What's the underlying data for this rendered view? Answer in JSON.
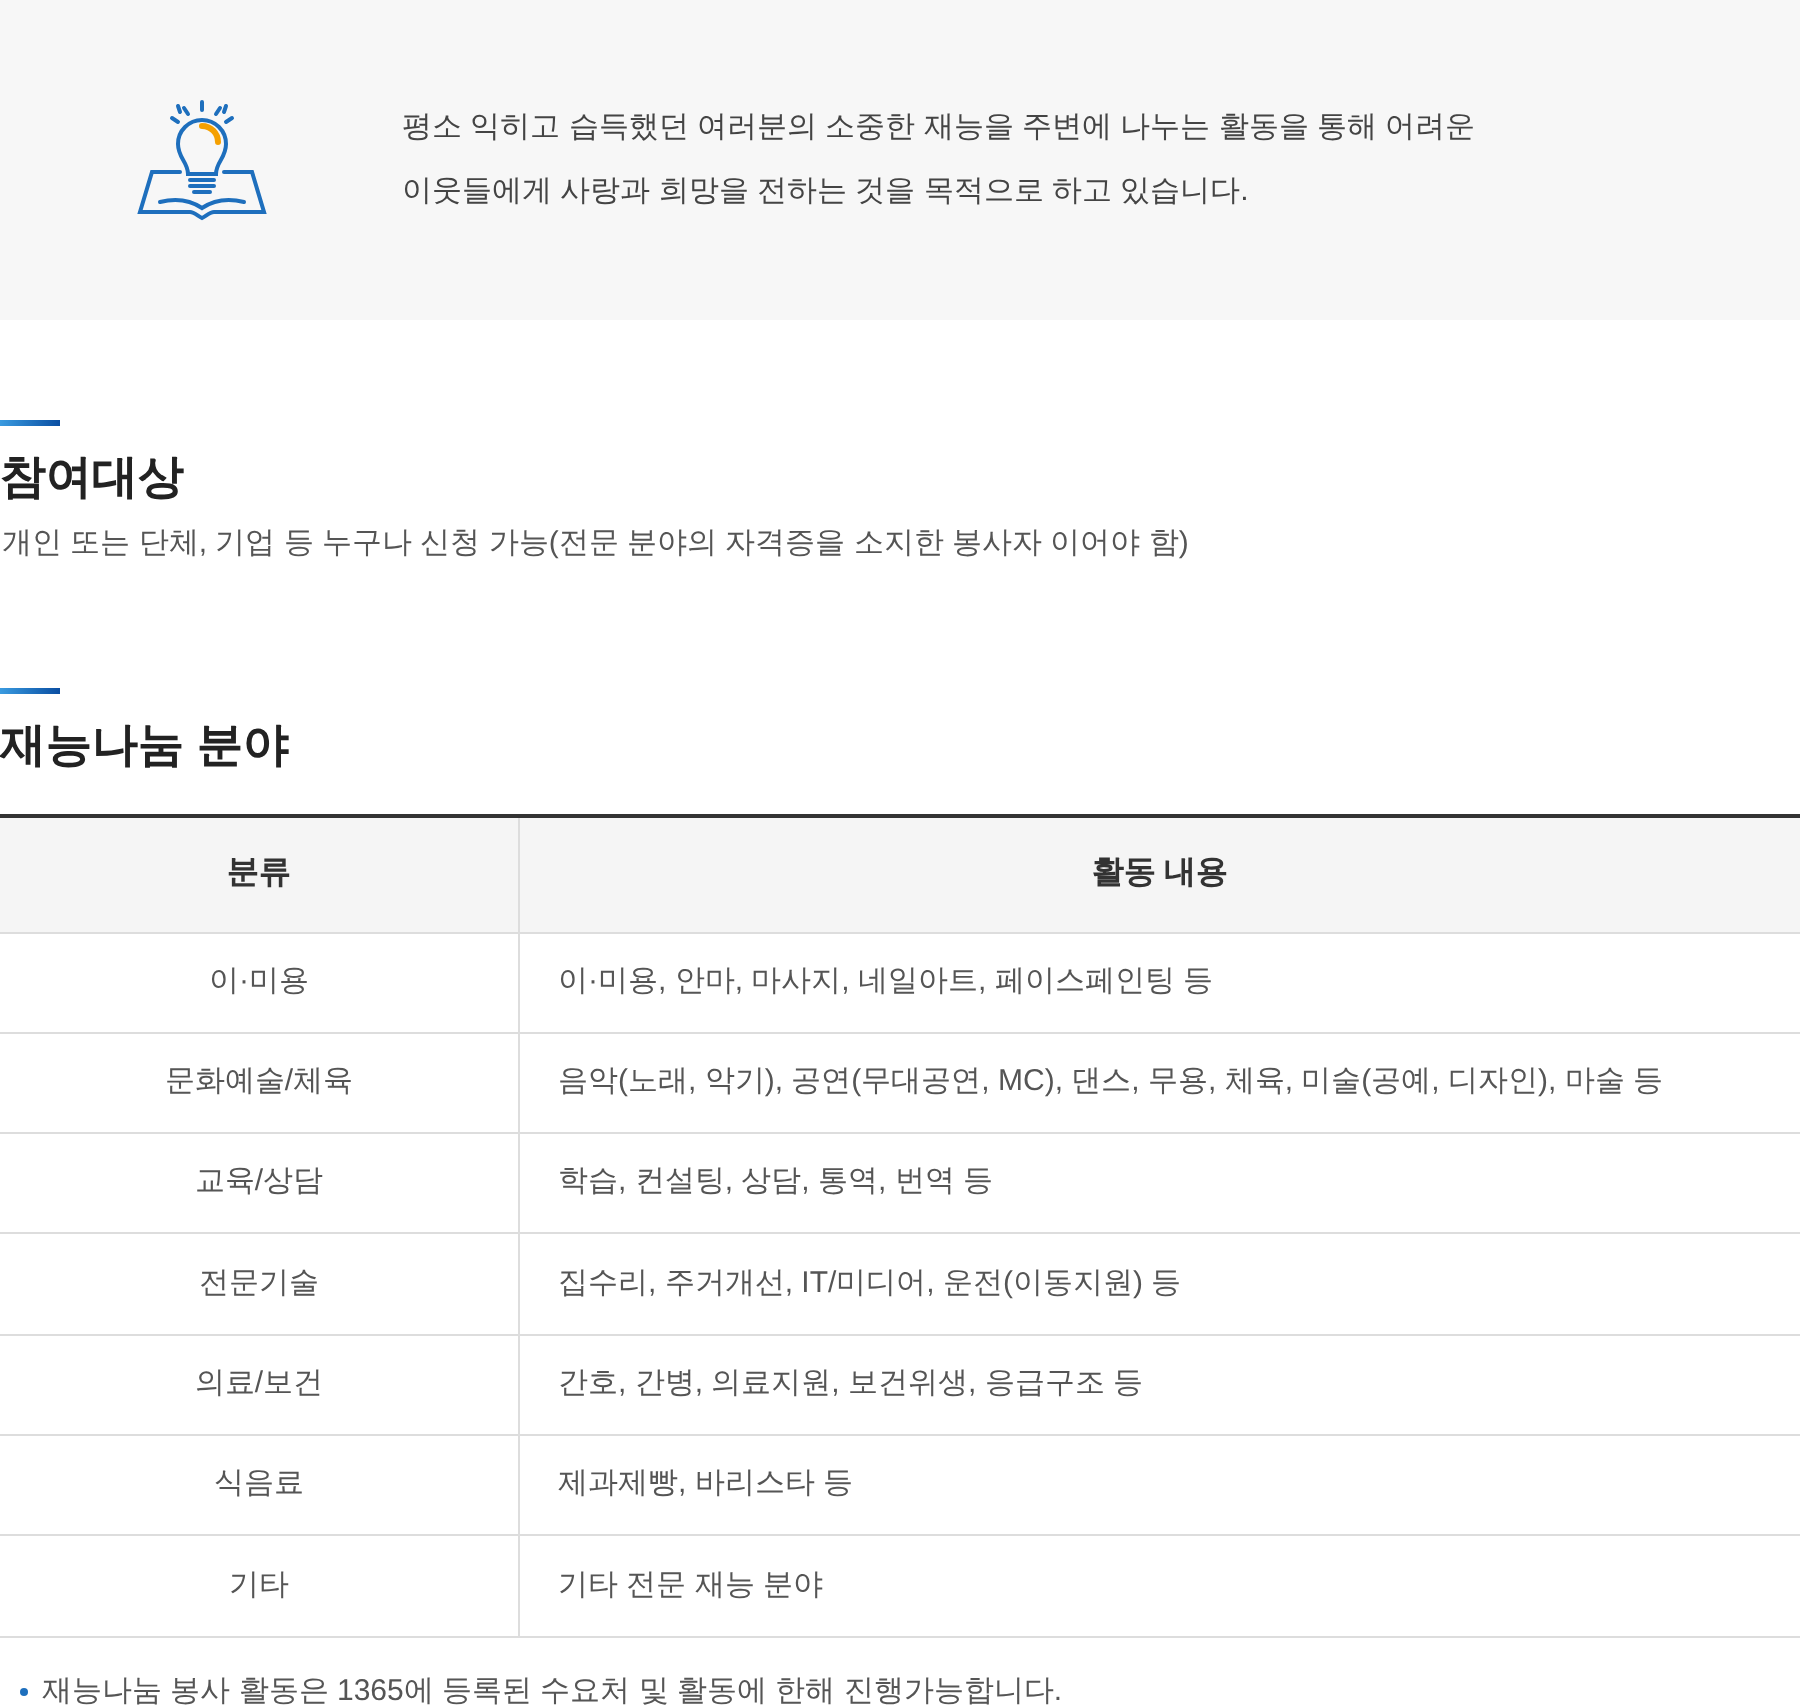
{
  "intro": {
    "lines": [
      "평소 익히고 습득했던 여러분의 소중한 재능을 주변에 나누는 활동을 통해 어려운",
      "이웃들에게 사랑과 희망을 전하는 것을 목적으로 하고 있습니다."
    ]
  },
  "sections": [
    {
      "title": "참여대상",
      "text": "개인 또는 단체, 기업 등 누구나 신청 가능(전문 분야의 자격증을 소지한 봉사자 이어야 함)"
    },
    {
      "title": "재능나눔 분야"
    }
  ],
  "table": {
    "columns": [
      "분류",
      "활동 내용"
    ],
    "rows": [
      [
        "이·미용",
        "이·미용, 안마, 마사지, 네일아트, 페이스페인팅 등"
      ],
      [
        "문화예술/체육",
        "음악(노래, 악기), 공연(무대공연, MC), 댄스, 무용, 체육, 미술(공예, 디자인), 마술 등"
      ],
      [
        "교육/상담",
        "학습, 컨설팅, 상담, 통역, 번역 등"
      ],
      [
        "전문기술",
        "집수리, 주거개선, IT/미디어, 운전(이동지원) 등"
      ],
      [
        "의료/보건",
        "간호, 간병, 의료지원, 보건위생, 응급구조 등"
      ],
      [
        "식음료",
        "제과제빵, 바리스타 등"
      ],
      [
        "기타",
        "기타 전문 재능 분야"
      ]
    ]
  },
  "note": "재능나눔 봉사 활동은 1365에 등록된 수요처 및 활동에 한해 진행가능합니다."
}
